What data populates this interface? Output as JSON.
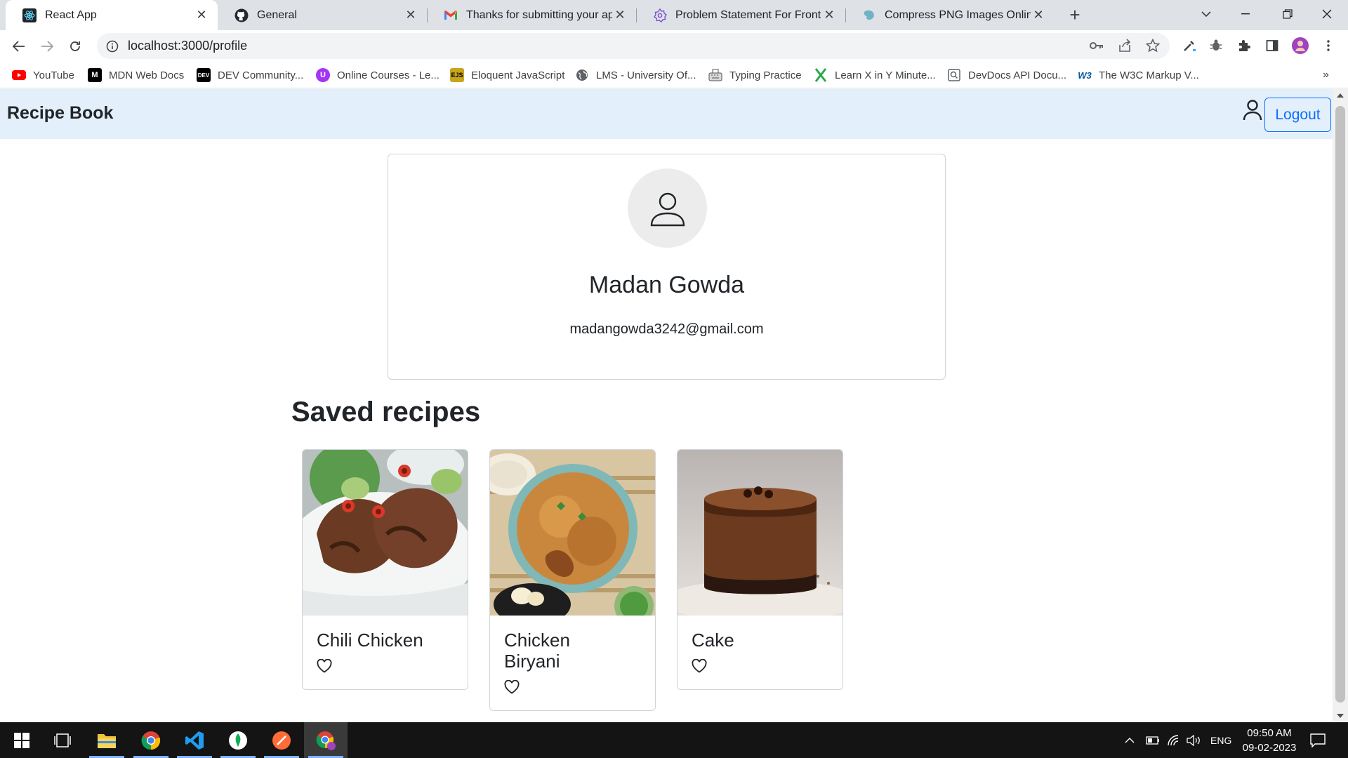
{
  "browser": {
    "tabs": [
      {
        "title": "React App",
        "icon": "react-icon"
      },
      {
        "title": "General",
        "icon": "github-icon"
      },
      {
        "title": "Thanks for submitting your applic",
        "icon": "gmail-icon"
      },
      {
        "title": "Problem Statement For Frontend",
        "icon": "settings-icon"
      },
      {
        "title": "Compress PNG Images Online",
        "icon": "tinypng-icon"
      }
    ],
    "url": "localhost:3000/profile",
    "bookmarks": [
      {
        "label": "YouTube",
        "icon": "youtube-icon",
        "color": "#ff0000"
      },
      {
        "label": "MDN Web Docs",
        "icon": "mdn-icon",
        "color": "#000000"
      },
      {
        "label": "DEV Community...",
        "icon": "dev-icon",
        "color": "#000000"
      },
      {
        "label": "Online Courses - Le...",
        "icon": "udemy-icon",
        "color": "#a435f0"
      },
      {
        "label": "Eloquent JavaScript",
        "icon": "ejs-icon",
        "color": "#c8a51c"
      },
      {
        "label": "LMS - University Of...",
        "icon": "globe-icon",
        "color": "#5f6368"
      },
      {
        "label": "Typing Practice",
        "icon": "keyboard-icon",
        "color": "#5f6368"
      },
      {
        "label": "Learn X in Y Minute...",
        "icon": "x-icon",
        "color": "#2aaa4a"
      },
      {
        "label": "DevDocs API Docu...",
        "icon": "devdocs-icon",
        "color": "#5f6368"
      },
      {
        "label": "The W3C Markup V...",
        "icon": "w3c-icon",
        "color": "#005a9c"
      }
    ]
  },
  "app": {
    "brand": "Recipe Book",
    "logout_label": "Logout",
    "accent": "#0d6efd",
    "navbar_bg": "#e3f0fb",
    "profile": {
      "name": "Madan Gowda",
      "email": "madangowda3242@gmail.com"
    },
    "saved_title": "Saved recipes",
    "recipes": [
      {
        "name": "Chili Chicken",
        "image": "chili-chicken-photo"
      },
      {
        "name": "Chicken Biryani",
        "image": "chicken-biryani-photo"
      },
      {
        "name": "Cake",
        "image": "chocolate-cake-photo"
      }
    ]
  },
  "taskbar": {
    "language": "ENG",
    "time": "09:50 AM",
    "date": "09-02-2023"
  }
}
